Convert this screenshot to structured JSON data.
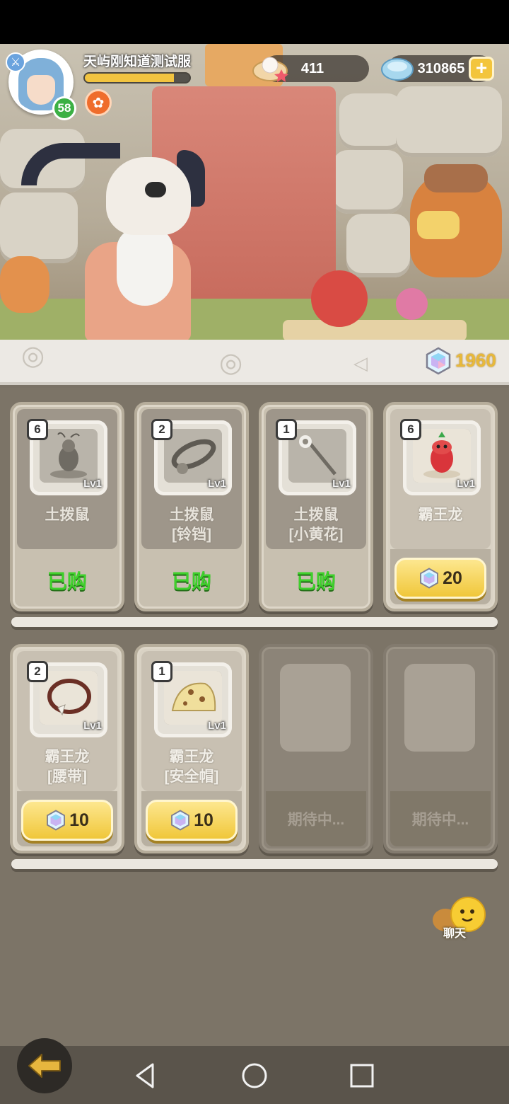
{
  "player": {
    "name": "天屿刚知道测试服",
    "level": "58",
    "exp_fraction": 0.85
  },
  "currencies": {
    "pearl_count": "411",
    "shell_count": "310865",
    "add_label": "+"
  },
  "shop": {
    "gem_balance": "1960",
    "items": [
      {
        "qty": "6",
        "lvl": "Lv1",
        "name_line1": "土拨鼠",
        "name_line2": "",
        "status": "已购",
        "price": ""
      },
      {
        "qty": "2",
        "lvl": "Lv1",
        "name_line1": "土拨鼠",
        "name_line2": "[铃铛]",
        "status": "已购",
        "price": ""
      },
      {
        "qty": "1",
        "lvl": "Lv1",
        "name_line1": "土拨鼠",
        "name_line2": "[小黄花]",
        "status": "已购",
        "price": ""
      },
      {
        "qty": "6",
        "lvl": "Lv1",
        "name_line1": "霸王龙",
        "name_line2": "",
        "status": "",
        "price": "20"
      },
      {
        "qty": "2",
        "lvl": "Lv1",
        "name_line1": "霸王龙",
        "name_line2": "[腰带]",
        "status": "",
        "price": "10"
      },
      {
        "qty": "1",
        "lvl": "Lv1",
        "name_line1": "霸王龙",
        "name_line2": "[安全帽]",
        "status": "",
        "price": "10"
      }
    ],
    "pending_label": "期待中..."
  },
  "chat": {
    "label": "聊天"
  },
  "colors": {
    "accent_gold": "#f0c73a",
    "purchased_green": "#3fd02c",
    "exp_bar": "#f2c440"
  },
  "icons": {
    "pearl": "pearl-shell-icon",
    "shell": "blue-shell-icon",
    "gem": "rainbow-gem-icon",
    "back": "back-arrow-icon"
  }
}
